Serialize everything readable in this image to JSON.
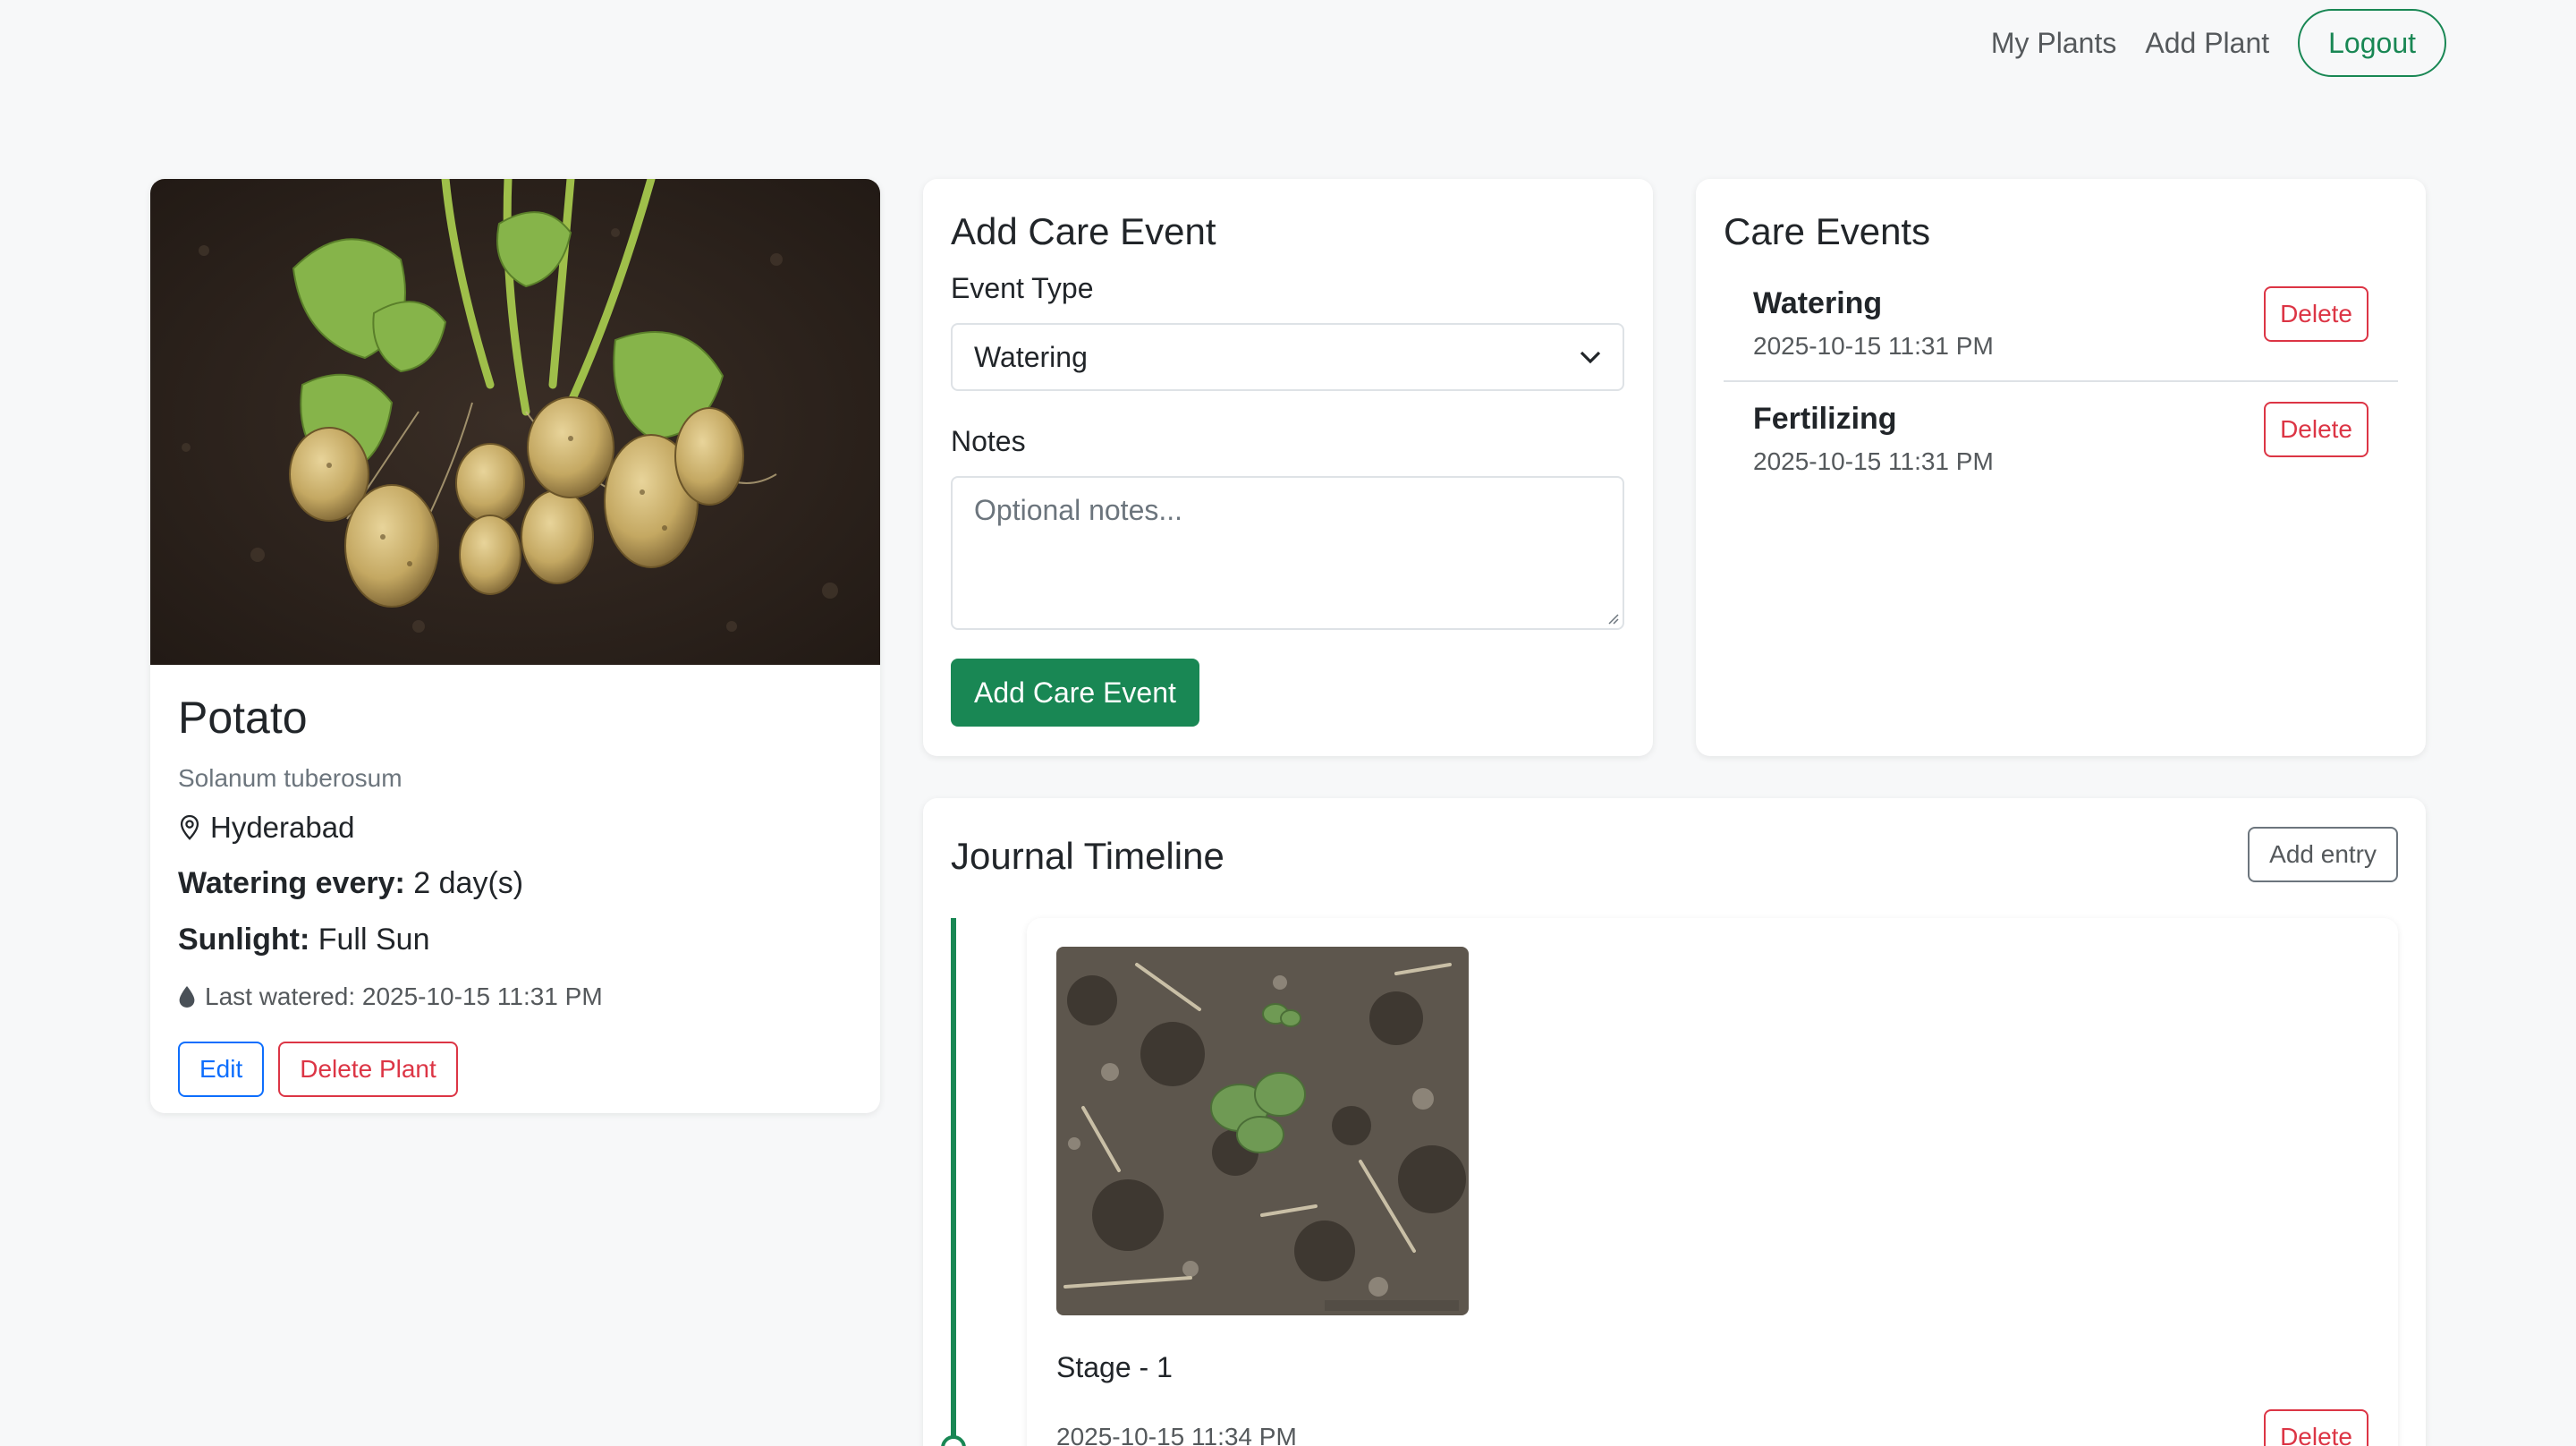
{
  "nav": {
    "my_plants": "My Plants",
    "add_plant": "Add Plant",
    "logout": "Logout"
  },
  "plant": {
    "name": "Potato",
    "scientific_name": "Solanum tuberosum",
    "location": "Hyderabad",
    "watering_label": "Watering every:",
    "watering_value": "2 day(s)",
    "sunlight_label": "Sunlight:",
    "sunlight_value": "Full Sun",
    "last_watered": "Last watered: 2025-10-15 11:31 PM",
    "edit_label": "Edit",
    "delete_label": "Delete Plant"
  },
  "add_event": {
    "title": "Add Care Event",
    "event_type_label": "Event Type",
    "event_type_value": "Watering",
    "notes_label": "Notes",
    "notes_placeholder": "Optional notes...",
    "submit_label": "Add Care Event"
  },
  "care_events": {
    "title": "Care Events",
    "items": [
      {
        "name": "Watering",
        "time": "2025-10-15 11:31 PM",
        "delete_label": "Delete"
      },
      {
        "name": "Fertilizing",
        "time": "2025-10-15 11:31 PM",
        "delete_label": "Delete"
      }
    ]
  },
  "journal": {
    "title": "Journal Timeline",
    "add_entry_label": "Add entry",
    "entries": [
      {
        "title": "Stage - 1",
        "time": "2025-10-15 11:34 PM",
        "delete_label": "Delete"
      }
    ]
  },
  "colors": {
    "accent": "#198754",
    "danger": "#dc3545",
    "primary": "#0d6efd"
  }
}
